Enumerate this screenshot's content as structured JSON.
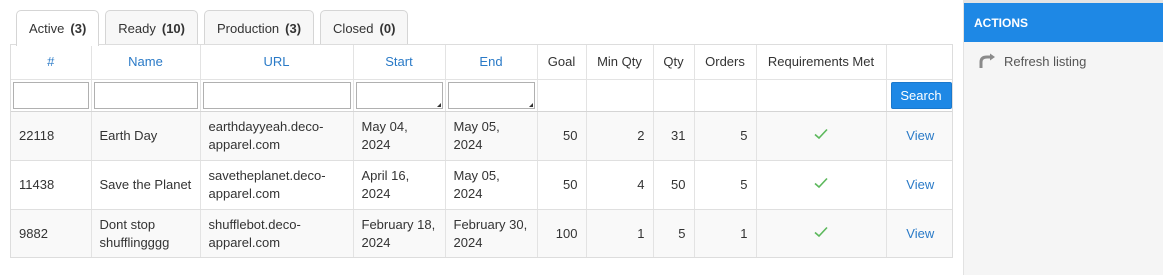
{
  "tabs": [
    {
      "label": "Active",
      "count": "(3)"
    },
    {
      "label": "Ready",
      "count": "(10)"
    },
    {
      "label": "Production",
      "count": "(3)"
    },
    {
      "label": "Closed",
      "count": "(0)"
    }
  ],
  "table": {
    "headers": {
      "num": "#",
      "name": "Name",
      "url": "URL",
      "start": "Start",
      "end": "End",
      "goal": "Goal",
      "min_qty": "Min Qty",
      "qty": "Qty",
      "orders": "Orders",
      "req": "Requirements Met"
    },
    "search_label": "Search",
    "view_label": "View",
    "rows": [
      {
        "num": "22118",
        "name": "Earth Day",
        "url": "earthdayyeah.deco-apparel.com",
        "start": "May 04, 2024",
        "end": "May 05, 2024",
        "goal": "50",
        "min_qty": "2",
        "qty": "31",
        "orders": "5",
        "req_met": true
      },
      {
        "num": "11438",
        "name": "Save the Planet",
        "url": "savetheplanet.deco-apparel.com",
        "start": "April 16, 2024",
        "end": "May 05, 2024",
        "goal": "50",
        "min_qty": "4",
        "qty": "50",
        "orders": "5",
        "req_met": true
      },
      {
        "num": "9882",
        "name": "Dont stop shufflingggg",
        "url": "shufflebot.deco-apparel.com",
        "start": "February 18, 2024",
        "end": "February 30, 2024",
        "goal": "100",
        "min_qty": "1",
        "qty": "5",
        "orders": "1",
        "req_met": true
      }
    ]
  },
  "actions": {
    "title": "ACTIONS",
    "refresh_label": "Refresh listing"
  },
  "colors": {
    "accent": "#1e88e5",
    "link": "#2a7ac7",
    "check": "#5cb85c"
  },
  "icons": {
    "check": "check-icon",
    "refresh": "refresh-icon"
  }
}
